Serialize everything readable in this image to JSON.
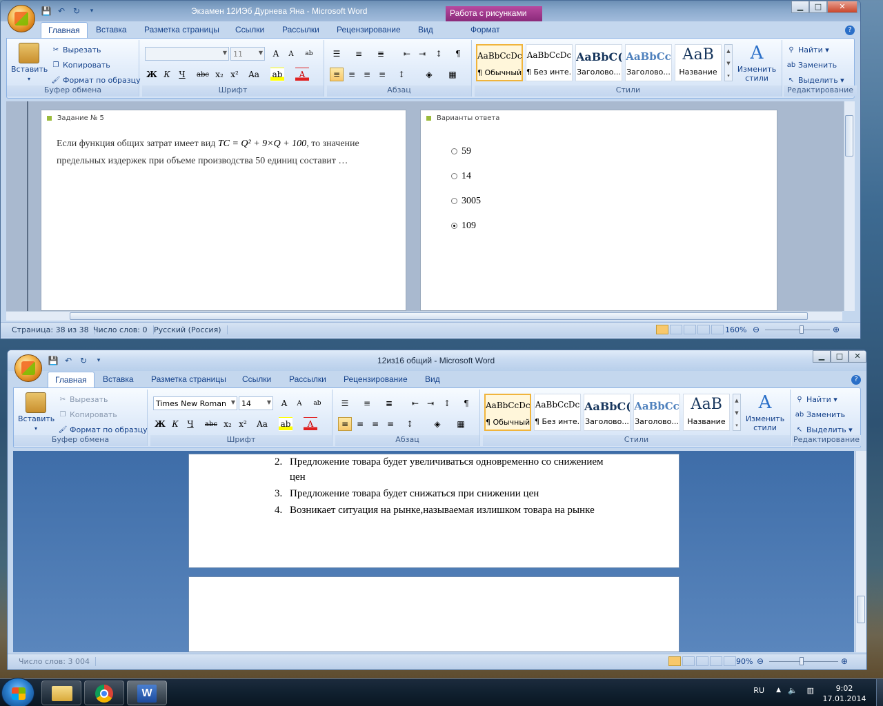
{
  "window1": {
    "title": "Экзамен 12ИЭб Дурнева Яна - Microsoft Word",
    "context_tab": "Работа с рисунками",
    "tabs": [
      "Главная",
      "Вставка",
      "Разметка страницы",
      "Ссылки",
      "Рассылки",
      "Рецензирование",
      "Вид",
      "Формат"
    ],
    "clipboard": {
      "paste": "Вставить",
      "cut": "Вырезать",
      "copy": "Копировать",
      "format_painter": "Формат по образцу",
      "label": "Буфер обмена"
    },
    "font": {
      "name": "",
      "size": "11",
      "label": "Шрифт"
    },
    "paragraph_label": "Абзац",
    "styles": [
      {
        "preview": "AaBbCcDc",
        "name": "¶ Обычный"
      },
      {
        "preview": "AaBbCcDc",
        "name": "¶ Без инте..."
      },
      {
        "preview": "AaBbC(",
        "name": "Заголово..."
      },
      {
        "preview": "AaBbCc",
        "name": "Заголово..."
      },
      {
        "preview": "АаВ",
        "name": "Название"
      }
    ],
    "change_styles": "Изменить стили",
    "styles_label": "Стили",
    "editing": {
      "find": "Найти",
      "replace": "Заменить",
      "select": "Выделить",
      "label": "Редактирование"
    },
    "task_panel": {
      "title": "Задание № 5",
      "text_before": "Если функция общих затрат имеет вид ",
      "formula": "TC = Q² + 9×Q + 100",
      "text_after": ", то значение предельных издержек при объеме производства 50 единиц составит …"
    },
    "answers_panel": {
      "title": "Варианты ответа",
      "options": [
        "59",
        "14",
        "3005",
        "109"
      ],
      "selected_index": 3
    },
    "status": {
      "page": "Страница: 38 из 38",
      "words": "Число слов: 0",
      "lang": "Русский (Россия)",
      "zoom": "160%"
    }
  },
  "window2": {
    "title": "12из16 общий - Microsoft Word",
    "tabs": [
      "Главная",
      "Вставка",
      "Разметка страницы",
      "Ссылки",
      "Рассылки",
      "Рецензирование",
      "Вид"
    ],
    "clipboard": {
      "paste": "Вставить",
      "cut": "Вырезать",
      "copy": "Копировать",
      "format_painter": "Формат по образцу",
      "label": "Буфер обмена"
    },
    "font": {
      "name": "Times New Roman",
      "size": "14",
      "label": "Шрифт"
    },
    "paragraph_label": "Абзац",
    "styles": [
      {
        "preview": "AaBbCcDc",
        "name": "¶ Обычный"
      },
      {
        "preview": "AaBbCcDc",
        "name": "¶ Без инте..."
      },
      {
        "preview": "AaBbC(",
        "name": "Заголово..."
      },
      {
        "preview": "AaBbCc",
        "name": "Заголово..."
      },
      {
        "preview": "АаВ",
        "name": "Название"
      }
    ],
    "change_styles": "Изменить стили",
    "styles_label": "Стили",
    "editing": {
      "find": "Найти",
      "replace": "Заменить",
      "select": "Выделить",
      "label": "Редактирование"
    },
    "list": [
      {
        "num": "2.",
        "text": "Предложение товара будет увеличиваться одновременно со снижением",
        "cont": "цен"
      },
      {
        "num": "3.",
        "text": "Предложение товара будет снижаться при снижении цен",
        "cont": ""
      },
      {
        "num": "4.",
        "text": "Возникает ситуация на рынке,называемая излишком товара на рынке",
        "cont": ""
      }
    ],
    "status": {
      "words": "Число слов: 3 004",
      "zoom": "90%"
    }
  },
  "taskbar": {
    "lang": "RU",
    "time": "9:02",
    "date": "17.01.2014"
  }
}
